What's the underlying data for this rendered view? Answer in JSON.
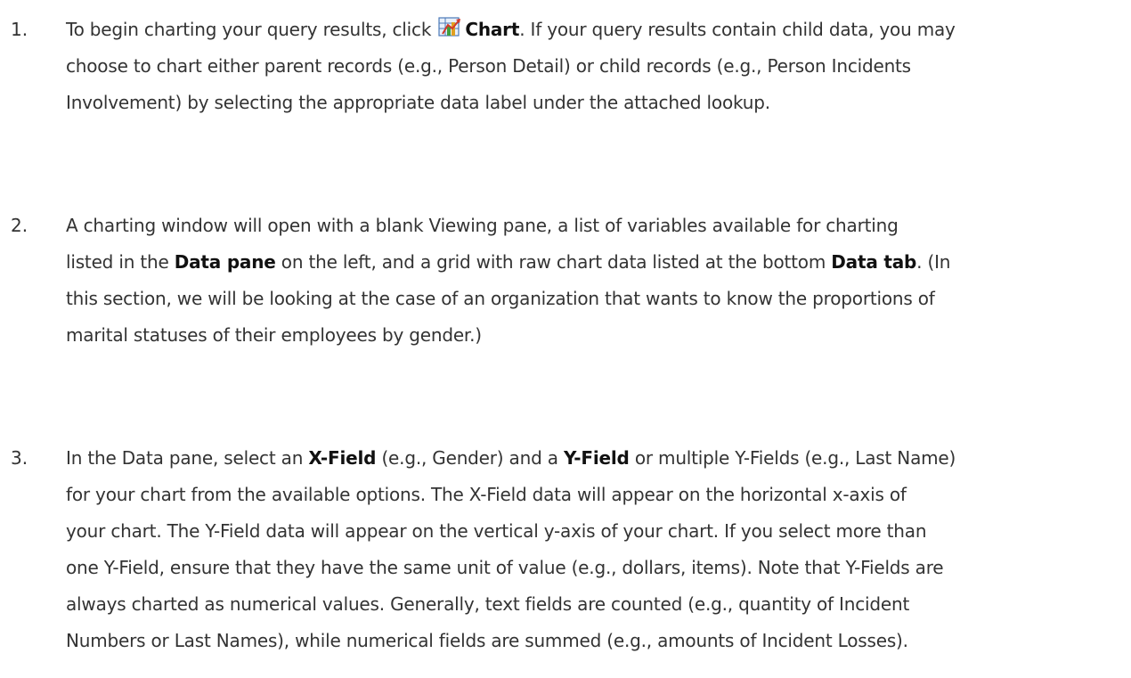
{
  "steps": [
    {
      "number": "1.",
      "lines": [
        [
          "To begin charting your query results, click ",
          "{icon}",
          "Chart",
          ". If your query results contain child data, you may"
        ],
        [
          "choose to chart either parent records (e.g., Person Detail) or child records (e.g., Person Incidents"
        ],
        [
          "Involvement) by selecting the appropriate data label under the attached lookup."
        ]
      ]
    },
    {
      "number": "2.",
      "lines": [
        [
          "A charting window will open with a blank Viewing pane, a list of variables available for charting"
        ],
        [
          "listed in the ",
          "Data pane",
          " on the left, and a grid with raw chart data listed at the bottom ",
          "Data tab",
          ". (In"
        ],
        [
          "this section, we will be looking at the case of an organization that wants to know the proportions of"
        ],
        [
          "marital statuses of their employees by gender.)"
        ]
      ]
    },
    {
      "number": "3.",
      "lines": [
        [
          "In the Data pane, select an ",
          "X-Field",
          " (e.g., Gender) and a ",
          "Y-Field",
          " or multiple Y-Fields (e.g., Last Name)"
        ],
        [
          "for your chart from the available options. The X-Field data will appear on the horizontal x-axis of"
        ],
        [
          "your chart. The Y-Field data will appear on the vertical y-axis of your chart. If you select more than"
        ],
        [
          "one Y-Field, ensure that they have the same unit of value (e.g., dollars, items). Note that Y-Fields are"
        ],
        [
          "always charted as numerical values. Generally, text fields are counted (e.g., quantity of Incident"
        ],
        [
          "Numbers or Last Names), while numerical fields are summed (e.g., amounts of Incident Losses)."
        ]
      ]
    }
  ],
  "icons": {
    "chart_button": "chart-icon"
  }
}
